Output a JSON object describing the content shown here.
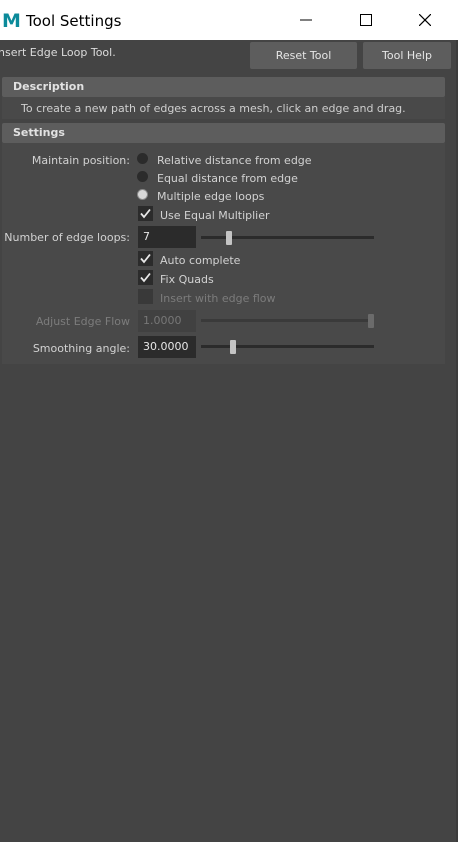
{
  "window": {
    "title": "Tool Settings",
    "app_icon": "M",
    "controls": {
      "minimize": "minimize-icon",
      "maximize": "maximize-icon",
      "close": "close-icon"
    }
  },
  "header": {
    "tool_name": "nsert Edge Loop Tool.",
    "reset_label": "Reset Tool",
    "help_label": "Tool Help"
  },
  "description": {
    "title": "Description",
    "text": "To create a new path of edges across a mesh, click an edge and drag."
  },
  "settings": {
    "title": "Settings",
    "maintain_position": {
      "label": "Maintain position:",
      "options": [
        "Relative distance from edge",
        "Equal distance from edge",
        "Multiple edge loops"
      ],
      "selected": "Multiple edge loops"
    },
    "use_equal_multiplier": {
      "label": "Use Equal Multiplier",
      "checked": true
    },
    "number_of_edge_loops": {
      "label": "Number of edge loops:",
      "value": "7",
      "slider_fraction": 0.17
    },
    "auto_complete": {
      "label": "Auto complete",
      "checked": true
    },
    "fix_quads": {
      "label": "Fix Quads",
      "checked": true
    },
    "insert_with_edge_flow": {
      "label": "Insert with edge flow",
      "checked": false,
      "enabled": false
    },
    "adjust_edge_flow": {
      "label": "Adjust Edge Flow",
      "value": "1.0000",
      "enabled": false,
      "slider_fraction": 1.0
    },
    "smoothing_angle": {
      "label": "Smoothing angle:",
      "value": "30.0000",
      "slider_fraction": 0.17
    }
  }
}
